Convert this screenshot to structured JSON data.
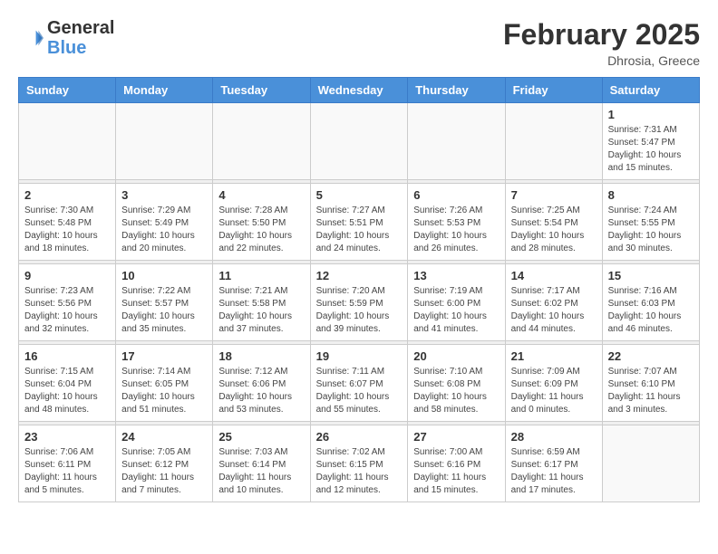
{
  "header": {
    "logo_general": "General",
    "logo_blue": "Blue",
    "month_title": "February 2025",
    "location": "Dhrosia, Greece"
  },
  "weekdays": [
    "Sunday",
    "Monday",
    "Tuesday",
    "Wednesday",
    "Thursday",
    "Friday",
    "Saturday"
  ],
  "weeks": [
    [
      {
        "day": "",
        "info": ""
      },
      {
        "day": "",
        "info": ""
      },
      {
        "day": "",
        "info": ""
      },
      {
        "day": "",
        "info": ""
      },
      {
        "day": "",
        "info": ""
      },
      {
        "day": "",
        "info": ""
      },
      {
        "day": "1",
        "info": "Sunrise: 7:31 AM\nSunset: 5:47 PM\nDaylight: 10 hours and 15 minutes."
      }
    ],
    [
      {
        "day": "2",
        "info": "Sunrise: 7:30 AM\nSunset: 5:48 PM\nDaylight: 10 hours and 18 minutes."
      },
      {
        "day": "3",
        "info": "Sunrise: 7:29 AM\nSunset: 5:49 PM\nDaylight: 10 hours and 20 minutes."
      },
      {
        "day": "4",
        "info": "Sunrise: 7:28 AM\nSunset: 5:50 PM\nDaylight: 10 hours and 22 minutes."
      },
      {
        "day": "5",
        "info": "Sunrise: 7:27 AM\nSunset: 5:51 PM\nDaylight: 10 hours and 24 minutes."
      },
      {
        "day": "6",
        "info": "Sunrise: 7:26 AM\nSunset: 5:53 PM\nDaylight: 10 hours and 26 minutes."
      },
      {
        "day": "7",
        "info": "Sunrise: 7:25 AM\nSunset: 5:54 PM\nDaylight: 10 hours and 28 minutes."
      },
      {
        "day": "8",
        "info": "Sunrise: 7:24 AM\nSunset: 5:55 PM\nDaylight: 10 hours and 30 minutes."
      }
    ],
    [
      {
        "day": "9",
        "info": "Sunrise: 7:23 AM\nSunset: 5:56 PM\nDaylight: 10 hours and 32 minutes."
      },
      {
        "day": "10",
        "info": "Sunrise: 7:22 AM\nSunset: 5:57 PM\nDaylight: 10 hours and 35 minutes."
      },
      {
        "day": "11",
        "info": "Sunrise: 7:21 AM\nSunset: 5:58 PM\nDaylight: 10 hours and 37 minutes."
      },
      {
        "day": "12",
        "info": "Sunrise: 7:20 AM\nSunset: 5:59 PM\nDaylight: 10 hours and 39 minutes."
      },
      {
        "day": "13",
        "info": "Sunrise: 7:19 AM\nSunset: 6:00 PM\nDaylight: 10 hours and 41 minutes."
      },
      {
        "day": "14",
        "info": "Sunrise: 7:17 AM\nSunset: 6:02 PM\nDaylight: 10 hours and 44 minutes."
      },
      {
        "day": "15",
        "info": "Sunrise: 7:16 AM\nSunset: 6:03 PM\nDaylight: 10 hours and 46 minutes."
      }
    ],
    [
      {
        "day": "16",
        "info": "Sunrise: 7:15 AM\nSunset: 6:04 PM\nDaylight: 10 hours and 48 minutes."
      },
      {
        "day": "17",
        "info": "Sunrise: 7:14 AM\nSunset: 6:05 PM\nDaylight: 10 hours and 51 minutes."
      },
      {
        "day": "18",
        "info": "Sunrise: 7:12 AM\nSunset: 6:06 PM\nDaylight: 10 hours and 53 minutes."
      },
      {
        "day": "19",
        "info": "Sunrise: 7:11 AM\nSunset: 6:07 PM\nDaylight: 10 hours and 55 minutes."
      },
      {
        "day": "20",
        "info": "Sunrise: 7:10 AM\nSunset: 6:08 PM\nDaylight: 10 hours and 58 minutes."
      },
      {
        "day": "21",
        "info": "Sunrise: 7:09 AM\nSunset: 6:09 PM\nDaylight: 11 hours and 0 minutes."
      },
      {
        "day": "22",
        "info": "Sunrise: 7:07 AM\nSunset: 6:10 PM\nDaylight: 11 hours and 3 minutes."
      }
    ],
    [
      {
        "day": "23",
        "info": "Sunrise: 7:06 AM\nSunset: 6:11 PM\nDaylight: 11 hours and 5 minutes."
      },
      {
        "day": "24",
        "info": "Sunrise: 7:05 AM\nSunset: 6:12 PM\nDaylight: 11 hours and 7 minutes."
      },
      {
        "day": "25",
        "info": "Sunrise: 7:03 AM\nSunset: 6:14 PM\nDaylight: 11 hours and 10 minutes."
      },
      {
        "day": "26",
        "info": "Sunrise: 7:02 AM\nSunset: 6:15 PM\nDaylight: 11 hours and 12 minutes."
      },
      {
        "day": "27",
        "info": "Sunrise: 7:00 AM\nSunset: 6:16 PM\nDaylight: 11 hours and 15 minutes."
      },
      {
        "day": "28",
        "info": "Sunrise: 6:59 AM\nSunset: 6:17 PM\nDaylight: 11 hours and 17 minutes."
      },
      {
        "day": "",
        "info": ""
      }
    ]
  ]
}
